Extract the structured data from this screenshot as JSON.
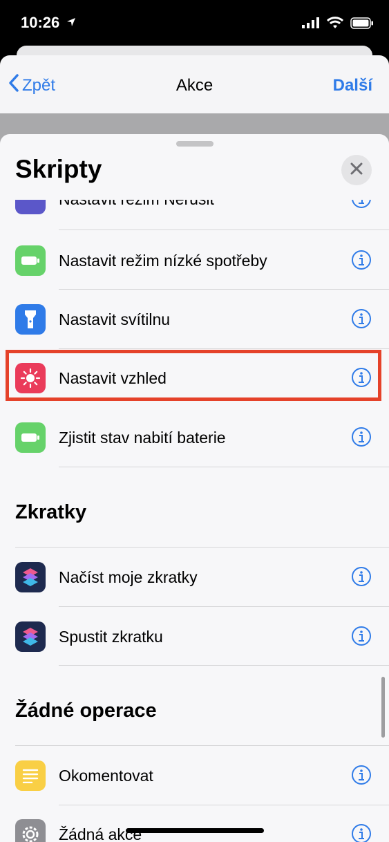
{
  "status": {
    "time": "10:26"
  },
  "nav": {
    "back_label": "Zpět",
    "title": "Akce",
    "next_label": "Další"
  },
  "sheet": {
    "title": "Skripty"
  },
  "rows_top": [
    {
      "label": "Nastavit režim Nerušit",
      "color": "#5b57c9",
      "icon": "moon-icon"
    },
    {
      "label": "Nastavit režim nízké spotřeby",
      "color": "#66d26a",
      "icon": "battery-icon"
    },
    {
      "label": "Nastavit svítilnu",
      "color": "#2f7be8",
      "icon": "flashlight-icon"
    },
    {
      "label": "Nastavit vzhled",
      "color": "#ea3b5a",
      "icon": "sun-icon"
    },
    {
      "label": "Zjistit stav nabití baterie",
      "color": "#66d26a",
      "icon": "battery-icon"
    }
  ],
  "sections": {
    "shortcuts": "Zkratky",
    "none": "Žádné operace"
  },
  "rows_shortcuts": [
    {
      "label": "Načíst moje zkratky",
      "icon": "shortcuts-icon"
    },
    {
      "label": "Spustit zkratku",
      "icon": "shortcuts-icon"
    }
  ],
  "rows_none": [
    {
      "label": "Okomentovat",
      "color": "#f9cf45",
      "icon": "comment-icon"
    },
    {
      "label": "Žádná akce",
      "color": "#8e8e93",
      "icon": "gear-icon"
    }
  ]
}
